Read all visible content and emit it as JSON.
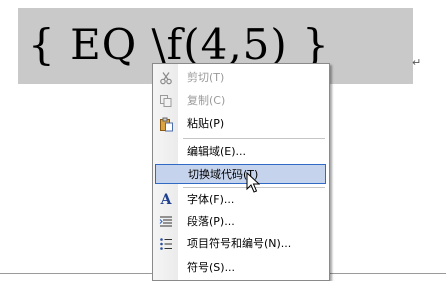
{
  "document": {
    "field_code": "{ EQ \\f(4,5) }",
    "paragraph_mark": "↵"
  },
  "context_menu": {
    "items": [
      {
        "label": "剪切(T)",
        "icon": "scissors-icon",
        "enabled": false
      },
      {
        "label": "复制(C)",
        "icon": "copy-icon",
        "enabled": false
      },
      {
        "label": "粘贴(P)",
        "icon": "paste-icon",
        "enabled": true
      },
      {
        "label": "编辑域(E)...",
        "icon": "",
        "enabled": true
      },
      {
        "label": "切换域代码(T)",
        "icon": "",
        "enabled": true,
        "highlighted": true
      },
      {
        "label": "字体(F)...",
        "icon": "font-icon",
        "enabled": true
      },
      {
        "label": "段落(P)...",
        "icon": "paragraph-icon",
        "enabled": true
      },
      {
        "label": "项目符号和编号(N)...",
        "icon": "bullets-icon",
        "enabled": true
      },
      {
        "label": "符号(S)...",
        "icon": "",
        "enabled": true
      }
    ]
  },
  "colors": {
    "field_shading": "#c9c9c9",
    "highlight_fill": "#c5d3ec",
    "highlight_border": "#316ac5"
  }
}
